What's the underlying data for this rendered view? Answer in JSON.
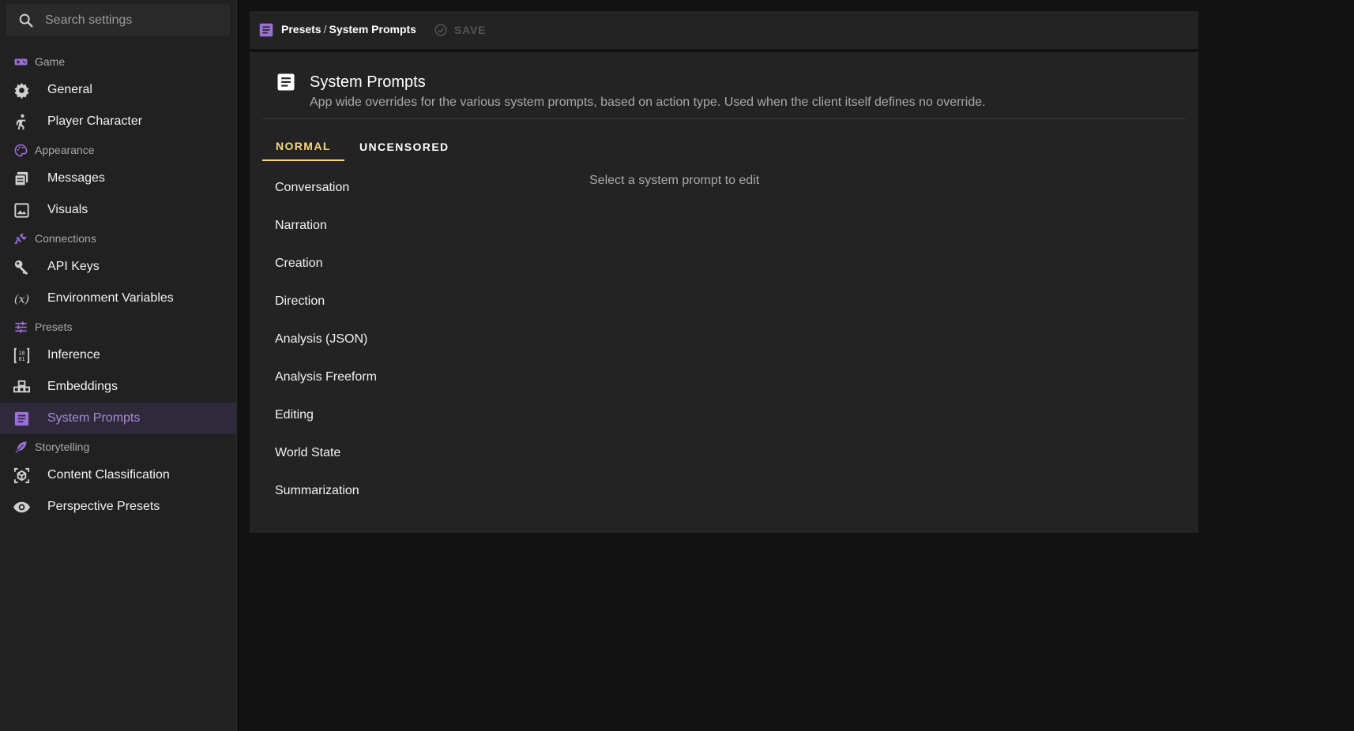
{
  "search": {
    "placeholder": "Search settings"
  },
  "sidebar": {
    "sections": [
      {
        "header": "Game",
        "header_icon": "gamepad-icon",
        "items": [
          {
            "label": "General",
            "icon": "gear-icon"
          },
          {
            "label": "Player Character",
            "icon": "person-icon"
          }
        ]
      },
      {
        "header": "Appearance",
        "header_icon": "palette-icon",
        "items": [
          {
            "label": "Messages",
            "icon": "messages-icon"
          },
          {
            "label": "Visuals",
            "icon": "image-icon"
          }
        ]
      },
      {
        "header": "Connections",
        "header_icon": "plug-icon",
        "items": [
          {
            "label": "API Keys",
            "icon": "key-icon"
          },
          {
            "label": "Environment Variables",
            "icon": "variable-icon"
          }
        ]
      },
      {
        "header": "Presets",
        "header_icon": "tune-icon",
        "items": [
          {
            "label": "Inference",
            "icon": "binary-icon"
          },
          {
            "label": "Embeddings",
            "icon": "blocks-icon"
          },
          {
            "label": "System Prompts",
            "icon": "document-icon",
            "active": true
          }
        ]
      },
      {
        "header": "Storytelling",
        "header_icon": "feather-icon",
        "items": [
          {
            "label": "Content Classification",
            "icon": "cube-scan-icon"
          },
          {
            "label": "Perspective Presets",
            "icon": "eye-icon"
          }
        ]
      }
    ]
  },
  "toolbar": {
    "breadcrumb_parent": "Presets",
    "breadcrumb_separator": "/",
    "breadcrumb_current": "System Prompts",
    "save_label": "SAVE"
  },
  "main": {
    "title": "System Prompts",
    "subtitle": "App wide overrides for the various system prompts, based on action type. Used when the client itself defines no override.",
    "tabs": [
      {
        "label": "NORMAL",
        "active": true
      },
      {
        "label": "UNCENSORED",
        "active": false
      }
    ],
    "prompt_types": [
      "Conversation",
      "Narration",
      "Creation",
      "Direction",
      "Analysis (JSON)",
      "Analysis Freeform",
      "Editing",
      "World State",
      "Summarization"
    ],
    "empty_message": "Select a system prompt to edit"
  },
  "colors": {
    "accent_purple": "#9a6fd8",
    "active_tab": "#f6d77a",
    "background": "#121212",
    "panel": "#232323"
  }
}
